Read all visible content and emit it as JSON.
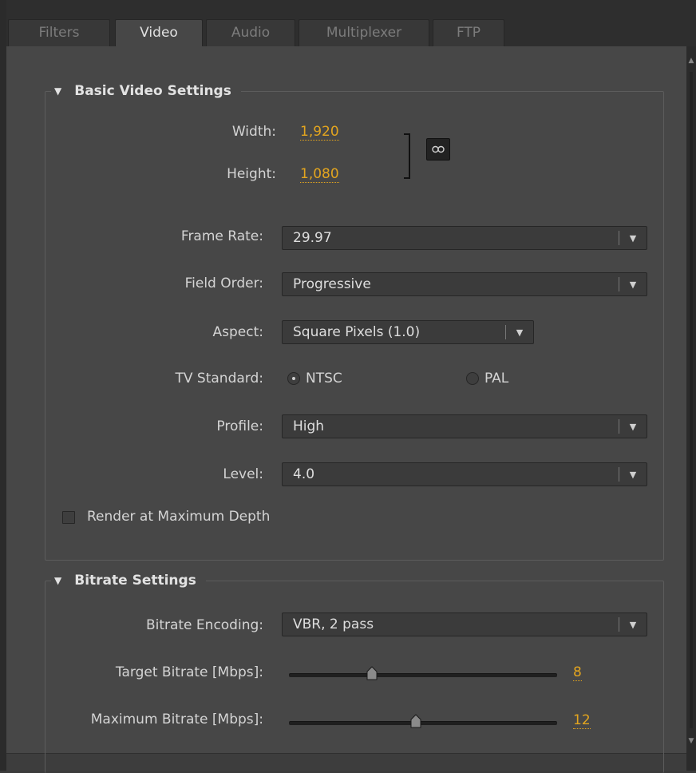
{
  "tabs": [
    {
      "label": "Filters",
      "active": false
    },
    {
      "label": "Video",
      "active": true
    },
    {
      "label": "Audio",
      "active": false
    },
    {
      "label": "Multiplexer",
      "active": false
    },
    {
      "label": "FTP",
      "active": false
    }
  ],
  "basic_video": {
    "title": "Basic Video Settings",
    "width_label": "Width:",
    "width_value": "1,920",
    "height_label": "Height:",
    "height_value": "1,080",
    "frame_rate_label": "Frame Rate:",
    "frame_rate_value": "29.97",
    "field_order_label": "Field Order:",
    "field_order_value": "Progressive",
    "aspect_label": "Aspect:",
    "aspect_value": "Square Pixels (1.0)",
    "tv_standard_label": "TV Standard:",
    "tv_ntsc_label": "NTSC",
    "tv_pal_label": "PAL",
    "tv_selected": "NTSC",
    "profile_label": "Profile:",
    "profile_value": "High",
    "level_label": "Level:",
    "level_value": "4.0",
    "render_max_depth_label": "Render at Maximum Depth",
    "render_max_depth_checked": false
  },
  "bitrate": {
    "title": "Bitrate Settings",
    "encoding_label": "Bitrate Encoding:",
    "encoding_value": "VBR, 2 pass",
    "target_label": "Target Bitrate [Mbps]:",
    "target_value": "8",
    "max_label": "Maximum Bitrate [Mbps]:",
    "max_value": "12"
  },
  "colors": {
    "accent_value": "#e3a51f",
    "panel_bg": "#474747",
    "control_bg": "#3b3b3b"
  }
}
